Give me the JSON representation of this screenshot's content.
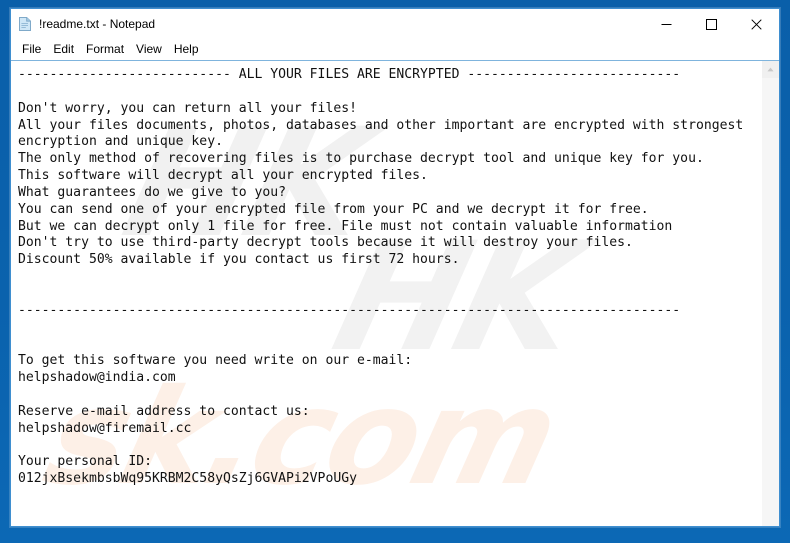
{
  "window": {
    "title": "!readme.txt - Notepad",
    "icon": "notepad-document-icon",
    "accent_color": "#0a62ad",
    "controls": {
      "minimize": "Minimize",
      "maximize": "Maximize",
      "close": "Close"
    }
  },
  "menu": {
    "items": [
      {
        "label": "File"
      },
      {
        "label": "Edit"
      },
      {
        "label": "Format"
      },
      {
        "label": "View"
      },
      {
        "label": "Help"
      }
    ]
  },
  "document": {
    "filename": "!readme.txt",
    "lines": [
      "--------------------------- ALL YOUR FILES ARE ENCRYPTED ---------------------------",
      "",
      "Don't worry, you can return all your files!",
      "All your files documents, photos, databases and other important are encrypted with strongest",
      "encryption and unique key.",
      "The only method of recovering files is to purchase decrypt tool and unique key for you.",
      "This software will decrypt all your encrypted files.",
      "What guarantees do we give to you?",
      "You can send one of your encrypted file from your PC and we decrypt it for free.",
      "But we can decrypt only 1 file for free. File must not contain valuable information",
      "Don't try to use third-party decrypt tools because it will destroy your files.",
      "Discount 50% available if you contact us first 72 hours.",
      "",
      "",
      "------------------------------------------------------------------------------------",
      "",
      "",
      "To get this software you need write on our e-mail:",
      "helpshadow@india.com",
      "",
      "Reserve e-mail address to contact us:",
      "helpshadow@firemail.cc",
      "",
      "Your personal ID:",
      "012jxBsekmbsbWq95KRBM2C58yQsZj6GVAPi2VPoUGy"
    ],
    "contact": {
      "primary_email": "helpshadow@india.com",
      "reserve_email": "helpshadow@firemail.cc",
      "personal_id": "012jxBsekmbsbWq95KRBM2C58yQsZj6GVAPi2VPoUGy",
      "discount_percent": "50%",
      "discount_window_hours": "72"
    }
  },
  "watermark": {
    "top_text": "HK",
    "mid_text": "HK",
    "bottom_text": "sk.com"
  },
  "scrollbar": {
    "up_arrow": "scroll-up-arrow",
    "down_arrow": "scroll-down-arrow"
  }
}
